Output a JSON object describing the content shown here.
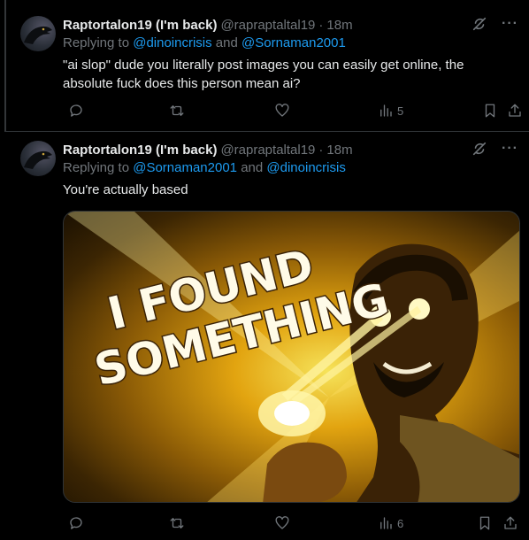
{
  "tweets": [
    {
      "name": "Raptortalon19 (I'm back)",
      "handle": "@rapraptaltal19",
      "sep": "·",
      "time": "18m",
      "replying_prefix": "Replying to ",
      "mention1": "@dinoincrisis",
      "and": " and ",
      "mention2": "@Sornaman2001",
      "text": "\"ai slop\" dude you literally post images you can easily get online, the absolute fuck does this person mean ai?",
      "views": "5"
    },
    {
      "name": "Raptortalon19 (I'm back)",
      "handle": "@rapraptaltal19",
      "sep": "·",
      "time": "18m",
      "replying_prefix": "Replying to ",
      "mention1": "@Sornaman2001",
      "and": " and ",
      "mention2": "@dinoincrisis",
      "text": "You're actually based",
      "views": "6",
      "image_text_line1": "I FOUND",
      "image_text_line2": "SOMETHING"
    }
  ],
  "icons": {
    "header": [
      "grok-icon",
      "more-icon"
    ],
    "actions": [
      "reply-icon",
      "retweet-icon",
      "like-icon",
      "views-icon",
      "bookmark-icon",
      "share-icon"
    ]
  },
  "colors": {
    "background": "#000000",
    "text": "#e7e9ea",
    "muted": "#71767b",
    "link": "#1d9bf0",
    "divider": "#2f3336"
  }
}
